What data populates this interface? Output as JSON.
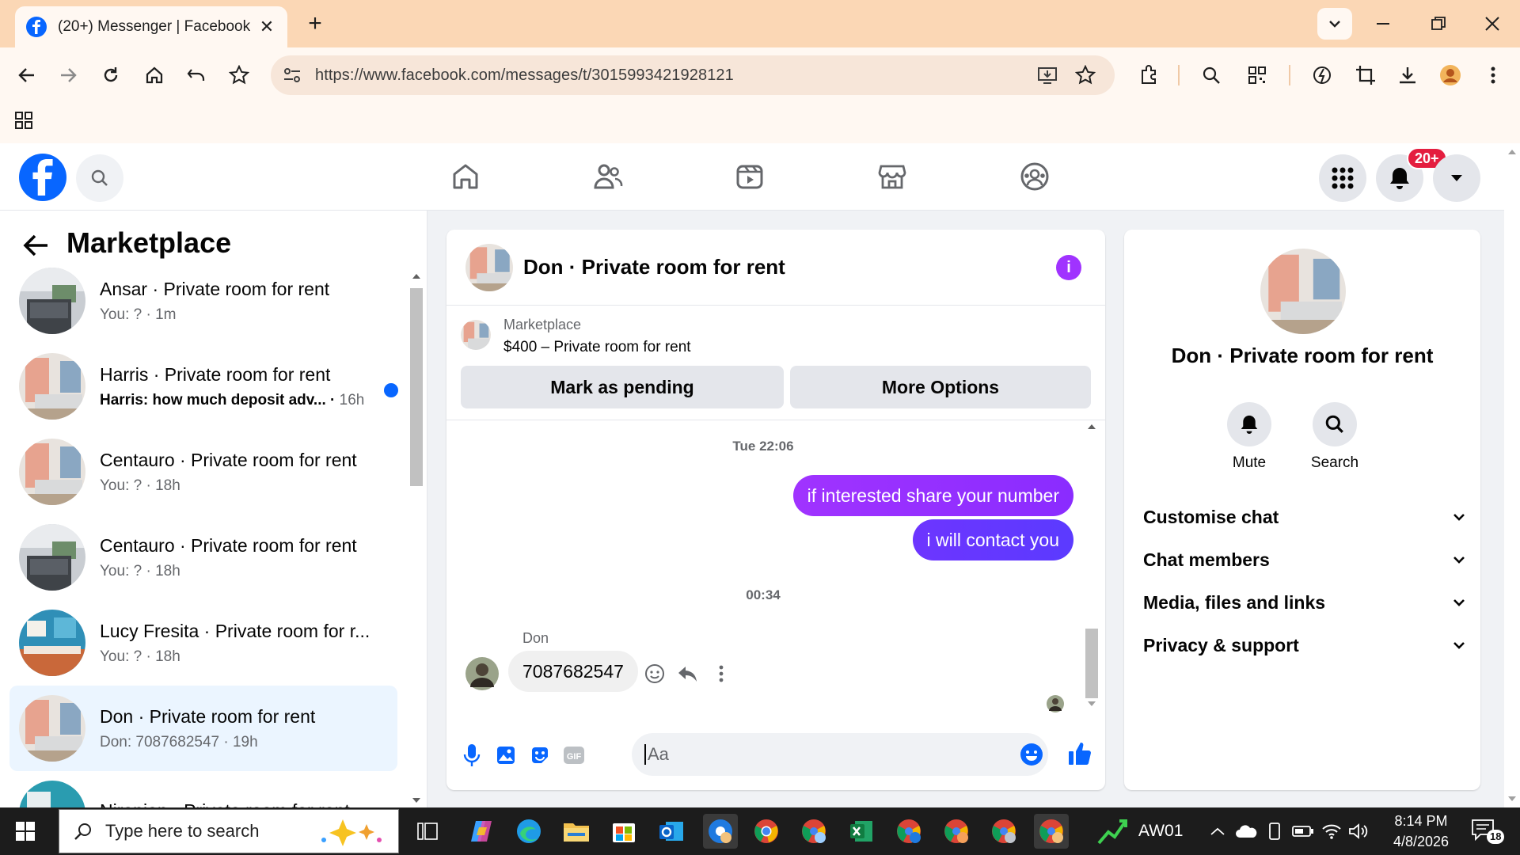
{
  "browser": {
    "tab_title": "(20+) Messenger | Facebook",
    "url": "https://www.facebook.com/messages/t/3015993421928121"
  },
  "nav": {
    "notifications_badge": "20+"
  },
  "left": {
    "title": "Marketplace",
    "conversations": [
      {
        "name": "Ansar · Private room for rent",
        "preview": "You: ?",
        "time": "1m",
        "unread": false,
        "active": false,
        "thumb": "grey"
      },
      {
        "name": "Harris · Private room for rent",
        "preview": "Harris: how much deposit adv...",
        "time": "16h",
        "unread": true,
        "active": false,
        "thumb": "pink"
      },
      {
        "name": "Centauro · Private room for rent",
        "preview": "You: ?",
        "time": "18h",
        "unread": false,
        "active": false,
        "thumb": "pink"
      },
      {
        "name": "Centauro · Private room for rent",
        "preview": "You: ?",
        "time": "18h",
        "unread": false,
        "active": false,
        "thumb": "grey"
      },
      {
        "name": "Lucy Fresita · Private room for r...",
        "preview": "You: ?",
        "time": "18h",
        "unread": false,
        "active": false,
        "thumb": "blue"
      },
      {
        "name": "Don · Private room for rent",
        "preview": "Don: 7087682547",
        "time": "19h",
        "unread": false,
        "active": true,
        "thumb": "pink"
      },
      {
        "name": "Niranjan · Private room for rent",
        "preview": "",
        "time": "",
        "unread": false,
        "active": false,
        "thumb": "teal"
      }
    ]
  },
  "chat": {
    "title": "Don · Private room for rent",
    "marketplace_label": "Marketplace",
    "listing": "$400 – Private room for rent",
    "mark_pending": "Mark as pending",
    "more_options": "More Options",
    "timestamp_1": "Tue 22:06",
    "outgoing_1": "if interested share your number",
    "outgoing_2": "i will contact you",
    "timestamp_2": "00:34",
    "sender_name": "Don",
    "incoming_1": "7087682547",
    "composer_placeholder": "Aa",
    "accent_gradient": [
      "#a033ff",
      "#5b3aff"
    ]
  },
  "right": {
    "title": "Don · Private room for rent",
    "mute_label": "Mute",
    "search_label": "Search",
    "sections": [
      "Customise chat",
      "Chat members",
      "Media, files and links",
      "Privacy & support"
    ]
  },
  "taskbar": {
    "search_placeholder": "Type here to search",
    "app_label": "AW01",
    "time": "8:14 PM",
    "date": "4/8/2026",
    "notification_count": "18"
  },
  "colors": {
    "facebook_blue": "#0866ff",
    "chrome_tabstrip": "#fbd7b5",
    "chrome_toolbar": "#fff8f2"
  }
}
